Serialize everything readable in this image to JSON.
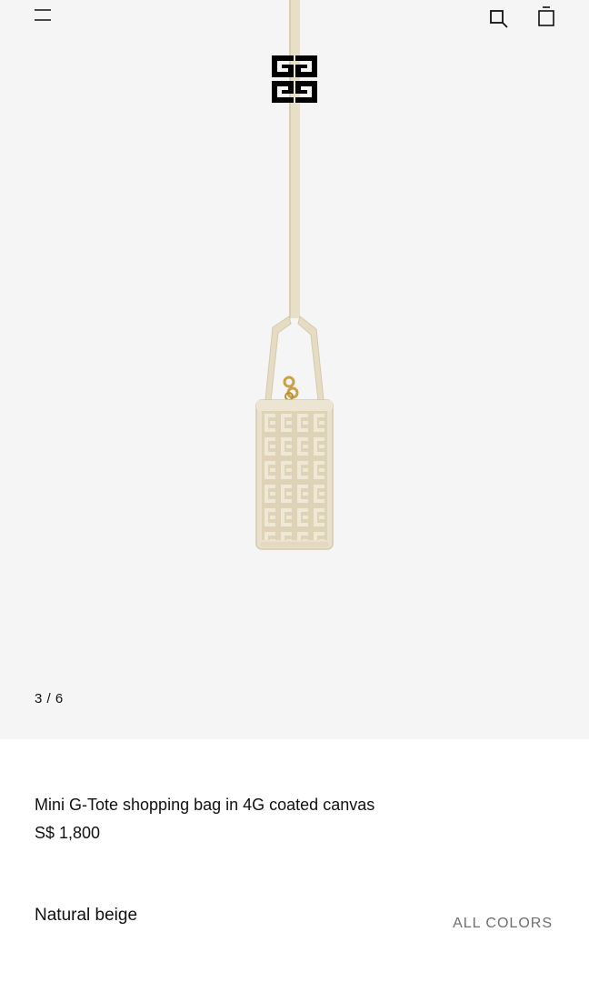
{
  "header": {
    "menu_icon": "hamburger-menu-icon",
    "search_icon": "search-icon",
    "bag_icon": "shopping-bag-icon",
    "logo": "4G-logo"
  },
  "gallery": {
    "counter": "3 / 6",
    "background_color": "#f5f5f5"
  },
  "product": {
    "title": "Mini G-Tote shopping bag in 4G coated canvas",
    "price": "S$ 1,800",
    "color_name": "Natural beige",
    "all_colors_label": "ALL COLORS"
  },
  "colors": {
    "bag_beige": "#e6dcc3",
    "strap_beige": "#e8dfc7",
    "hardware_gold": "#c9a146"
  }
}
